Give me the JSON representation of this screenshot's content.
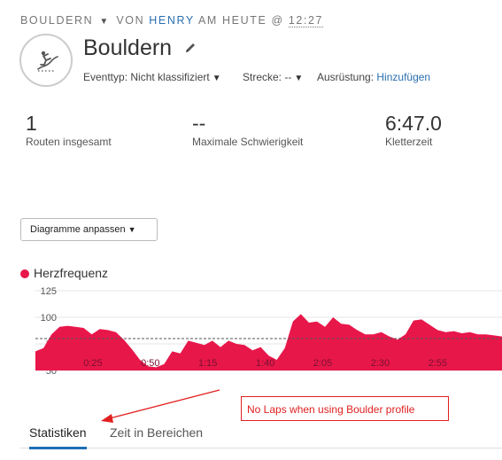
{
  "breadcrumb": {
    "activity": "BOULDERN",
    "prefix": "VON",
    "user": "HENRY",
    "middle": "AM HEUTE @",
    "time": "12:27"
  },
  "header": {
    "title": "Bouldern",
    "event_type": "Eventtyp: Nicht klassifiziert",
    "route": "Strecke: --",
    "equipment_label": "Ausrüstung:",
    "equipment_link": "Hinzufügen"
  },
  "stats": [
    {
      "value": "1",
      "label": "Routen insgesamt"
    },
    {
      "value": "--",
      "label": "Maximale Schwierigkeit"
    },
    {
      "value": "6:47.0",
      "label": "Kletterzeit"
    }
  ],
  "customize_button": "Diagramme anpassen",
  "chart_data": {
    "type": "area",
    "series": [
      {
        "name": "Herzfrequenz",
        "color": "#e8174a",
        "x": [
          0,
          7,
          14,
          21,
          28,
          35,
          42,
          49,
          56,
          63,
          70,
          77,
          84,
          91,
          98,
          105,
          112,
          119,
          126,
          133,
          140,
          147,
          154,
          161,
          168,
          175,
          182,
          189,
          196,
          203,
          210,
          217,
          224,
          231,
          238,
          245,
          252,
          259,
          266,
          273,
          280,
          287,
          294,
          301,
          308,
          315,
          322,
          329,
          336,
          343,
          350,
          357,
          364,
          371,
          378,
          385,
          392,
          399,
          406
        ],
        "values": [
          68,
          71,
          84,
          91,
          92,
          91,
          90,
          84,
          89,
          88,
          86,
          79,
          70,
          60,
          54,
          53,
          56,
          68,
          66,
          78,
          76,
          74,
          78,
          72,
          78,
          75,
          74,
          69,
          72,
          64,
          60,
          71,
          96,
          103,
          95,
          96,
          91,
          100,
          94,
          93,
          88,
          84,
          84,
          86,
          82,
          79,
          84,
          97,
          98,
          93,
          88,
          86,
          87,
          85,
          86,
          84,
          84,
          83,
          82
        ]
      }
    ],
    "y_ticks": [
      125,
      100,
      75,
      50
    ],
    "y_ticks_labels": [
      "125",
      "100",
      "75",
      "50"
    ],
    "ylim": [
      50,
      130
    ],
    "x_tick_labels": [
      "0:25",
      "0:50",
      "1:15",
      "1:40",
      "2:05",
      "2:30",
      "2:55"
    ],
    "x_ticks_seconds": [
      25,
      50,
      75,
      100,
      125,
      150,
      175
    ],
    "xlim": [
      0,
      203
    ],
    "reference_line": 80,
    "legend": "top-left",
    "grid": true
  },
  "annotation": "No Laps when using Boulder profile",
  "tabs": [
    {
      "label": "Statistiken",
      "active": true
    },
    {
      "label": "Zeit in Bereichen",
      "active": false
    }
  ]
}
